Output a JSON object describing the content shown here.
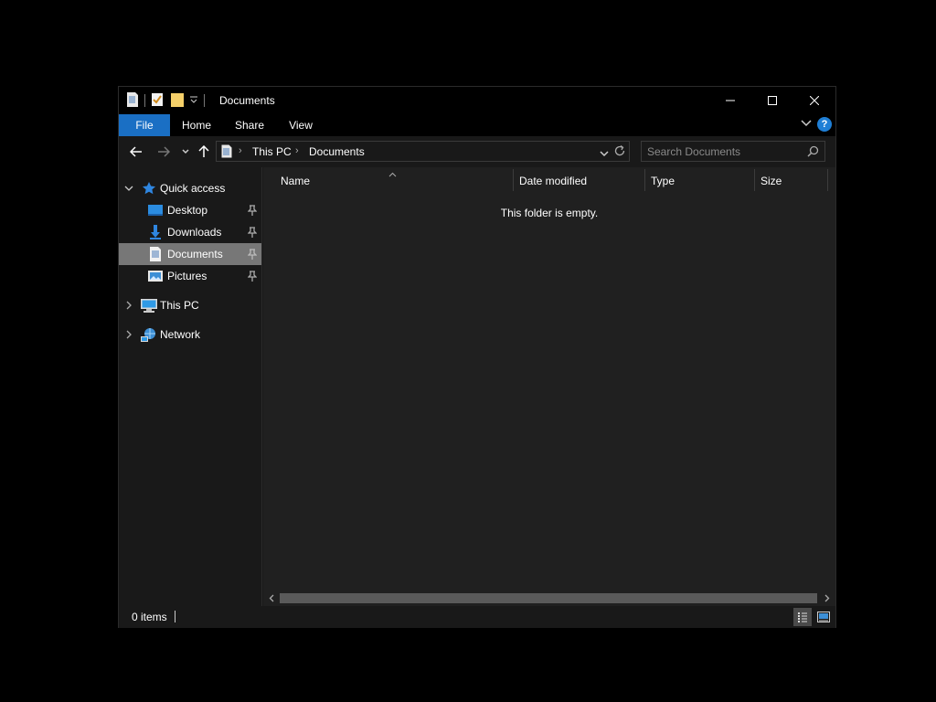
{
  "window": {
    "title": "Documents"
  },
  "ribbon": {
    "tabs": [
      {
        "label": "File"
      },
      {
        "label": "Home"
      },
      {
        "label": "Share"
      },
      {
        "label": "View"
      }
    ],
    "help_label": "?"
  },
  "address": {
    "breadcrumbs": [
      "This PC",
      "Documents"
    ]
  },
  "search": {
    "placeholder": "Search Documents"
  },
  "sidebar": {
    "items": [
      {
        "label": "Quick access",
        "icon": "star-icon",
        "expanded": true
      },
      {
        "label": "Desktop",
        "icon": "desktop-folder-icon",
        "pinned": true
      },
      {
        "label": "Downloads",
        "icon": "download-arrow-icon",
        "pinned": true
      },
      {
        "label": "Documents",
        "icon": "document-icon",
        "pinned": true,
        "selected": true
      },
      {
        "label": "Pictures",
        "icon": "pictures-icon",
        "pinned": true
      },
      {
        "label": "This PC",
        "icon": "computer-icon",
        "expanded": false
      },
      {
        "label": "Network",
        "icon": "network-icon",
        "expanded": false
      }
    ]
  },
  "content": {
    "columns": [
      "Name",
      "Date modified",
      "Type",
      "Size"
    ],
    "empty_message": "This folder is empty."
  },
  "status": {
    "items_count": "0 items"
  },
  "colors": {
    "accent": "#1a6fc4",
    "selection": "#777777",
    "background": "#191919",
    "content_background": "#202020"
  }
}
